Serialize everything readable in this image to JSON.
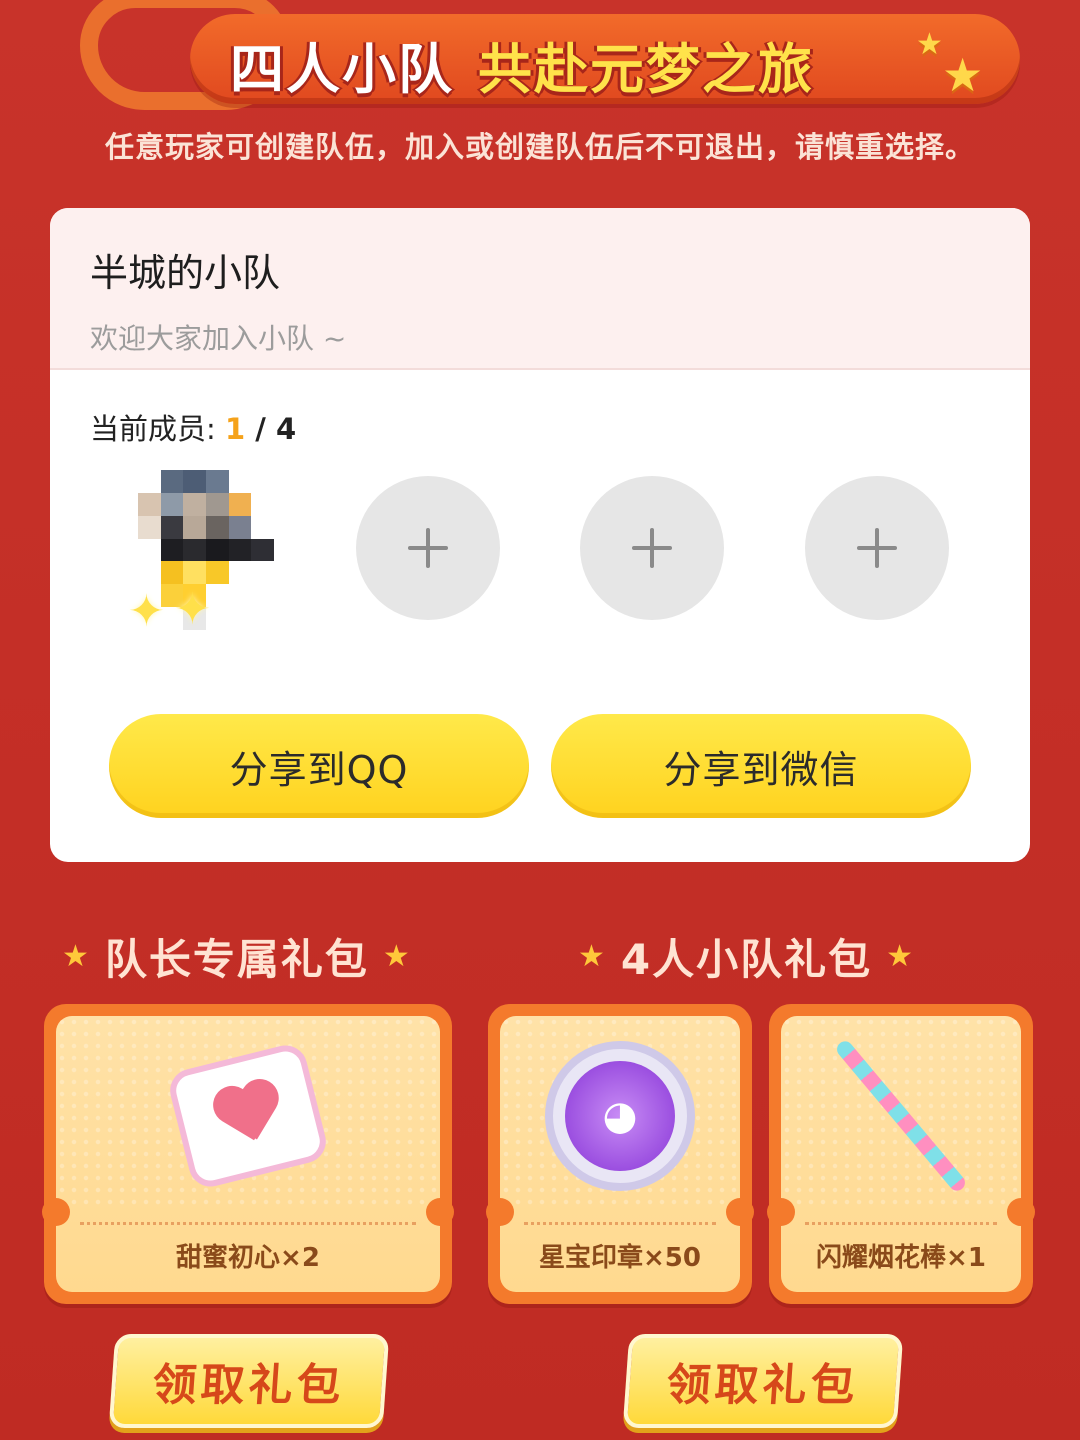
{
  "header": {
    "title_part1": "四人小队",
    "title_part2": "共赴元梦之旅",
    "subtitle": "任意玩家可创建队伍，加入或创建队伍后不可退出，请慎重选择。"
  },
  "team": {
    "name": "半城的小队",
    "description": "欢迎大家加入小队 ~",
    "members_label": "当前成员: ",
    "members_current": "1",
    "members_separator": " / ",
    "members_total": "4",
    "empty_slots": [
      {
        "icon": "plus-icon"
      },
      {
        "icon": "plus-icon"
      },
      {
        "icon": "plus-icon"
      }
    ],
    "share_qq_label": "分享到QQ",
    "share_wechat_label": "分享到微信"
  },
  "gifts": {
    "leader": {
      "title": "队长专属礼包",
      "items": [
        {
          "label": "甜蜜初心×2",
          "icon": "candy-heart-icon"
        }
      ],
      "claim_label": "领取礼包"
    },
    "squad": {
      "title": "4人小队礼包",
      "items": [
        {
          "label": "星宝印章×50",
          "icon": "star-seal-icon"
        },
        {
          "label": "闪耀烟花棒×1",
          "icon": "firework-stick-icon"
        }
      ],
      "claim_label": "领取礼包"
    }
  },
  "colors": {
    "background": "#c42f27",
    "accent_yellow": "#ffd21e",
    "member_count": "#f5a21a"
  }
}
